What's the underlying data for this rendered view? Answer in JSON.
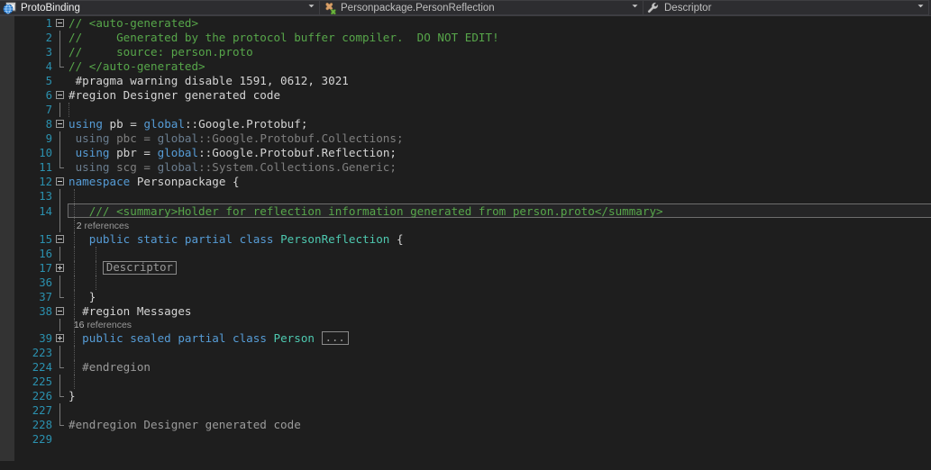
{
  "navbar": {
    "project": {
      "label": "ProtoBinding",
      "icon": "web-project-icon",
      "arrow": "▼"
    },
    "type": {
      "label": "Personpackage.PersonReflection",
      "icon": "class-icon",
      "arrow": "▼"
    },
    "member": {
      "label": "Descriptor",
      "icon": "wrench-icon",
      "arrow": "▼"
    }
  },
  "editor": {
    "collapsed_descriptor": "Descriptor",
    "collapsed_ellipsis": "...",
    "lens_2": {
      "count": "2",
      "word": "references"
    },
    "lens_16": {
      "count": "16",
      "word": "references"
    },
    "lines": [
      {
        "n": "1",
        "text": "// <auto-generated>"
      },
      {
        "n": "2",
        "text": "//     Generated by the protocol buffer compiler.  DO NOT EDIT!"
      },
      {
        "n": "3",
        "text": "//     source: person.proto"
      },
      {
        "n": "4",
        "text": "// </auto-generated>"
      },
      {
        "n": "5",
        "text": "#pragma warning disable 1591, 0612, 3021"
      },
      {
        "n": "6",
        "text": "#region Designer generated code"
      },
      {
        "n": "7",
        "text": ""
      },
      {
        "n": "8",
        "text": "using pb = global::Google.Protobuf;"
      },
      {
        "n": "9",
        "text": "using pbc = global::Google.Protobuf.Collections;"
      },
      {
        "n": "10",
        "text": "using pbr = global::Google.Protobuf.Reflection;"
      },
      {
        "n": "11",
        "text": "using scg = global::System.Collections.Generic;"
      },
      {
        "n": "12",
        "text": "namespace Personpackage {"
      },
      {
        "n": "13",
        "text": ""
      },
      {
        "n": "14",
        "text": "  /// <summary>Holder for reflection information generated from person.proto</summary>"
      },
      {
        "n": "15",
        "text": "  public static partial class PersonReflection {"
      },
      {
        "n": "16",
        "text": ""
      },
      {
        "n": "17",
        "text": "    Descriptor"
      },
      {
        "n": "36",
        "text": ""
      },
      {
        "n": "37",
        "text": "  }"
      },
      {
        "n": "38",
        "text": "  #region Messages"
      },
      {
        "n": "39",
        "text": "  public sealed partial class Person ..."
      },
      {
        "n": "223",
        "text": ""
      },
      {
        "n": "224",
        "text": "  #endregion"
      },
      {
        "n": "225",
        "text": ""
      },
      {
        "n": "226",
        "text": "}"
      },
      {
        "n": "227",
        "text": ""
      },
      {
        "n": "228",
        "text": "#endregion Designer generated code"
      },
      {
        "n": "229",
        "text": ""
      }
    ],
    "colors": {
      "background": "#1e1e1e",
      "navbar_background": "#2d2d30",
      "margin": "#333333",
      "line_number": "#2b91af",
      "comment": "#57a64a",
      "keyword": "#569cd6",
      "type": "#4ec9b0",
      "number": "#b5cea8",
      "plain_text": "#d4d4d4",
      "unused_dim": "#7f7f7f",
      "codelens": "#999999",
      "current_line_border": "#6e6e6e"
    }
  }
}
